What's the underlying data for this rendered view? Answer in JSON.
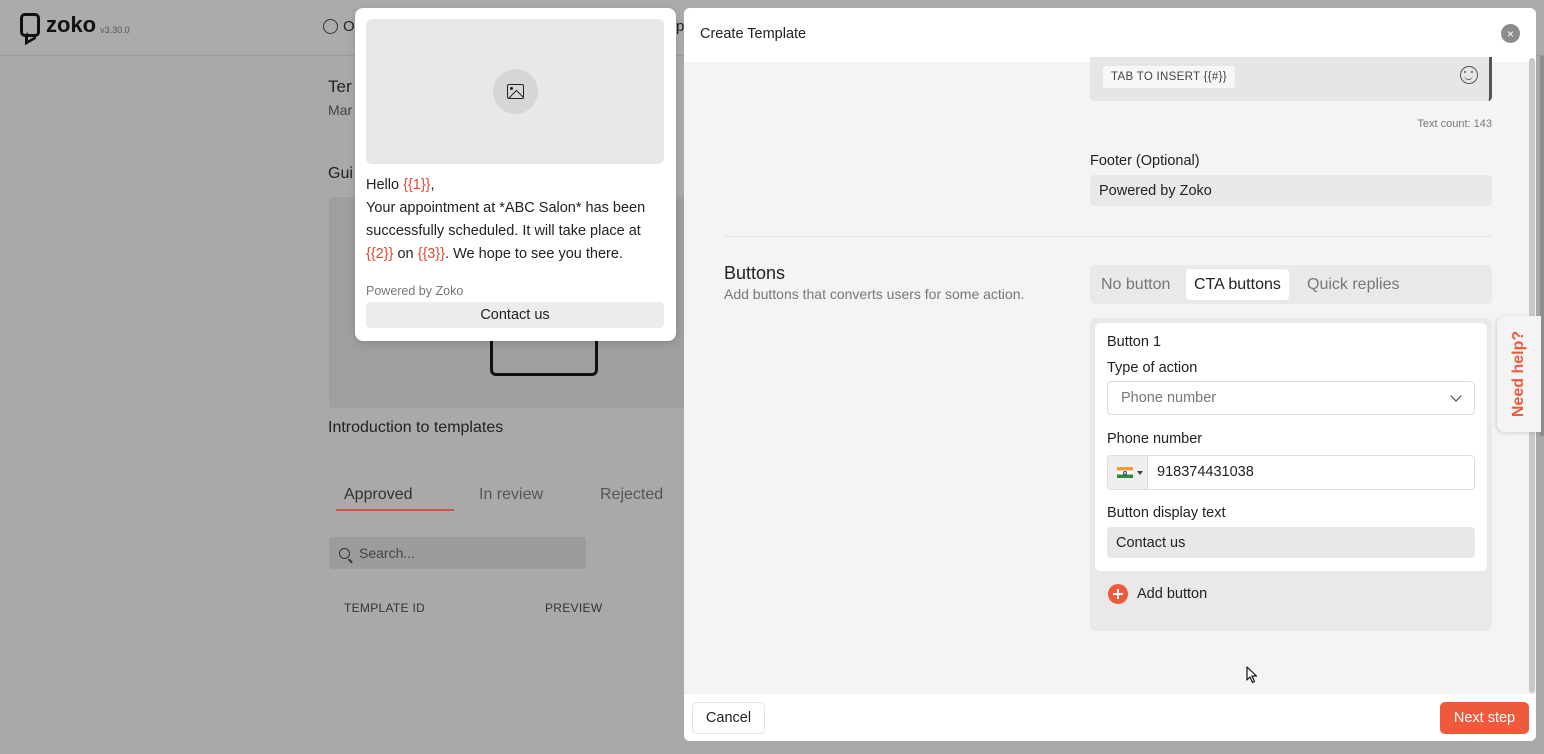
{
  "app": {
    "logo_text": "zoko",
    "version": "v3.30.0",
    "topbar_radio_label": "O",
    "topbar_cut_label": "p"
  },
  "background": {
    "title_fragment": "Ter",
    "subtitle_fragment": "Mar",
    "guide_fragment": "Gui",
    "guide_caption": "Introduction to templates",
    "tabs": [
      "Approved",
      "In review",
      "Rejected"
    ],
    "search_placeholder": "Search...",
    "table_headers": [
      "TEMPLATE ID",
      "PREVIEW"
    ]
  },
  "preview": {
    "greeting": "Hello ",
    "var1": "{{1}}",
    "comma": ",",
    "line2": "Your appointment at *ABC Salon* has been successfully scheduled. It will take place at ",
    "var2": "{{2}}",
    "on": " on ",
    "var3": "{{3}}",
    "line_end": ". We hope to see you there.",
    "footer": "Powered by Zoko",
    "cta": "Contact us"
  },
  "modal": {
    "title": "Create Template",
    "close_glyph": "×",
    "tab_insert": "TAB TO INSERT {{#}}",
    "text_count": "Text count: 143",
    "footer_label": "Footer (Optional)",
    "footer_value": "Powered by Zoko",
    "buttons_title": "Buttons",
    "buttons_desc": "Add buttons that converts users for some action.",
    "button_types": [
      "No button",
      "CTA buttons",
      "Quick replies"
    ],
    "active_button_type": "CTA buttons",
    "button_card": {
      "title": "Button 1",
      "type_label": "Type of action",
      "type_value": "Phone number",
      "phone_label": "Phone number",
      "phone_value": "918374431038",
      "display_label": "Button display text",
      "display_value": "Contact us"
    },
    "add_button": "Add button",
    "cancel": "Cancel",
    "next": "Next step"
  },
  "help": {
    "label": "Need help?"
  },
  "colors": {
    "accent": "#ef5a3c",
    "variable": "#e24a30"
  }
}
